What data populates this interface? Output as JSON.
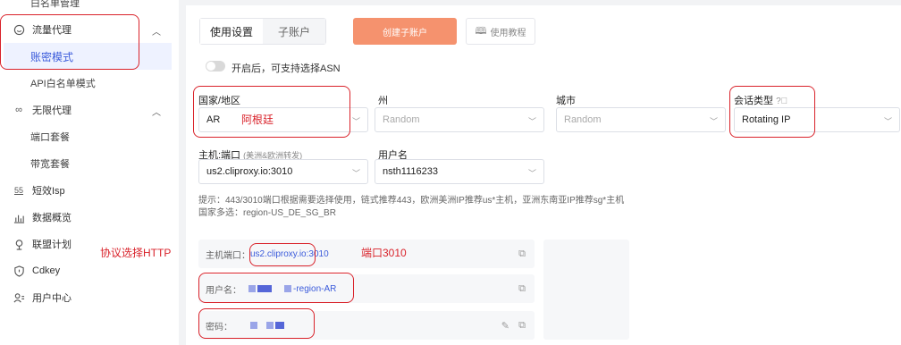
{
  "sidebar": {
    "partial_top": "白名单管理",
    "items": [
      {
        "label": "流量代理",
        "icon": "droplet-icon",
        "expanded": true
      },
      {
        "label": "账密模式",
        "active": true
      },
      {
        "label": "API白名单模式"
      },
      {
        "label": "无限代理",
        "icon": "infinity-icon",
        "expanded": true
      },
      {
        "label": "端口套餐"
      },
      {
        "label": "带宽套餐"
      },
      {
        "label": "短效Isp",
        "icon": "clock-icon"
      },
      {
        "label": "数据概览",
        "icon": "chart-icon"
      },
      {
        "label": "联盟计划",
        "icon": "location-icon"
      },
      {
        "label": "Cdkey",
        "icon": "shield-icon"
      },
      {
        "label": "用户中心",
        "icon": "user-list-icon"
      }
    ]
  },
  "tabs": [
    "使用设置",
    "子账户"
  ],
  "buttons": {
    "create": "创建子账户",
    "tutorial": "使用教程"
  },
  "toggle": {
    "label": "开启后，可支持选择ASN",
    "on": false
  },
  "fields": {
    "country": {
      "label": "国家/地区",
      "value": "AR"
    },
    "state": {
      "label": "州",
      "placeholder": "Random"
    },
    "city": {
      "label": "城市",
      "placeholder": "Random"
    },
    "session": {
      "label": "会话类型",
      "value": "Rotating IP"
    },
    "host": {
      "label": "主机:端口",
      "note": "(美洲&欧洲转发)",
      "value": "us2.cliproxy.io:3010"
    },
    "username": {
      "label": "用户名",
      "value": "nsth1116233"
    }
  },
  "hint": {
    "line1": "提示：443/3010端口根据需要选择使用，链式推荐443，欧洲美洲IP推荐us*主机，亚洲东南亚IP推荐sg*主机",
    "line2": "国家多选：region-US_DE_SG_BR"
  },
  "result": {
    "host_label": "主机端口：",
    "host_domain": "us2.cliproxy.io",
    "host_port": ":3010",
    "user_label": "用户名：",
    "user_suffix": "-region-AR",
    "pass_label": "密码："
  },
  "annotations": {
    "country_note": "阿根廷",
    "protocol_note": "协议选择HTTP",
    "port_note": "端口3010"
  },
  "colors": {
    "accent": "#3b5bdb",
    "create_button": "#f5926e",
    "annotation_red": "#d9222a"
  }
}
